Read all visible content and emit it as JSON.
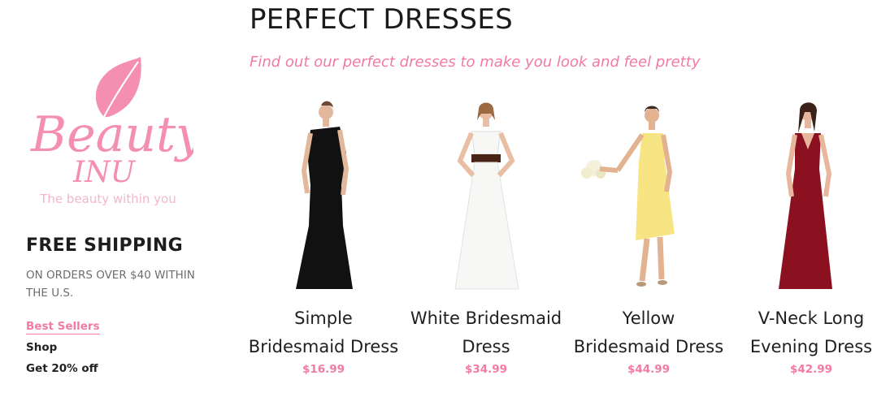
{
  "brand": {
    "logo_line1": "Beauty",
    "logo_line2": "INU",
    "tagline": "The beauty within you",
    "pink": "#f27aa3"
  },
  "page": {
    "title": "PERFECT DRESSES",
    "subtitle": "Find out our perfect dresses to make you look and feel pretty"
  },
  "shipping": {
    "title": "FREE SHIPPING",
    "subtitle": "ON ORDERS OVER $40 WITHIN THE U.S."
  },
  "nav": {
    "items": [
      {
        "label": "Best Sellers",
        "active": true
      },
      {
        "label": "Shop",
        "active": false
      },
      {
        "label": "Get 20% off",
        "active": false
      }
    ]
  },
  "products": [
    {
      "name_line1": "Simple",
      "name_line2": "Bridesmaid Dress",
      "price": "$16.99",
      "dress_color": "#111111"
    },
    {
      "name_line1": "White Bridesmaid",
      "name_line2": "Dress",
      "price": "$34.99",
      "dress_color": "#f7f7f5"
    },
    {
      "name_line1": "Yellow",
      "name_line2": "Bridesmaid Dress",
      "price": "$44.99",
      "dress_color": "#f7e483"
    },
    {
      "name_line1": "V-Neck Long",
      "name_line2": "Evening Dress",
      "price": "$42.99",
      "dress_color": "#8b1020"
    }
  ]
}
